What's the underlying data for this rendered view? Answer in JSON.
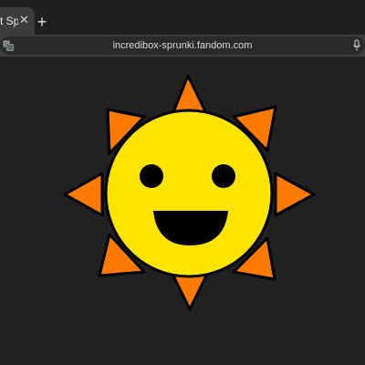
{
  "browser": {
    "tab": {
      "title": "Sprunki",
      "title_visible": "t Spr"
    },
    "new_tab_symbol": "+",
    "close_symbol": "✕",
    "address_bar": {
      "url": "incredibox-sprunki.fandom.com"
    },
    "icons": [
      "translate-icon",
      "microphone-icon",
      "close-icon",
      "plus-icon"
    ]
  },
  "page": {
    "image": "smiling-sun",
    "colors": {
      "background": "#212121",
      "sun_face": "#FFE400",
      "sun_rays": "#FF7A00",
      "outline": "#000000"
    }
  }
}
